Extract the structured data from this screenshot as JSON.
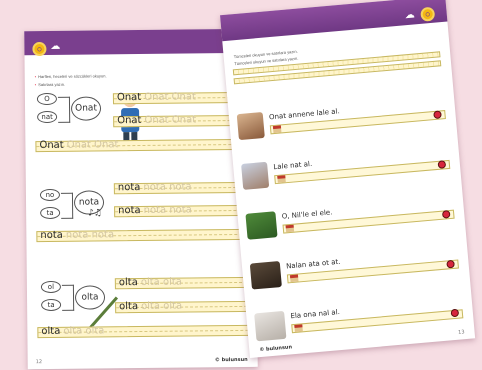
{
  "left_page": {
    "page_number": "12",
    "brand": "© bulunsun",
    "instructions": [
      "Harfleri, heceleri ve sözcükleri okuyun.",
      "Satırlara yazın."
    ],
    "groups": [
      {
        "syllables": [
          "O",
          "nat"
        ],
        "word": "Onat",
        "trace": "Onat Onat",
        "row3_trace": "Onat Onat"
      },
      {
        "syllables": [
          "no",
          "ta"
        ],
        "word": "nota",
        "trace": "nota nota",
        "row3_trace": "nota nota"
      },
      {
        "syllables": [
          "ol",
          "ta"
        ],
        "word": "olta",
        "trace": "olta olta",
        "row3_trace": "olta olta"
      }
    ]
  },
  "right_page": {
    "page_number": "13",
    "brand": "© bulunsun",
    "instructions": [
      "Tümceleri okuyun ve satırlara yazın.",
      "Tümceleri okuyun ve satırlara yazın."
    ],
    "sentences": [
      "Onat annene lale al.",
      "Lale nat al.",
      "O, Nil'le el ele.",
      "Nalan ata ot at.",
      "Ela ona nal al."
    ]
  },
  "colors": {
    "band": "#7a3f8e",
    "accent": "#f3b712",
    "line_fill": "#fff5cc",
    "background": "#f6dde3"
  },
  "icons": [
    "coin-icon",
    "lamb-icon",
    "book-icon",
    "ladybug-icon",
    "house-icon",
    "music-note-icon",
    "pencil-icon"
  ]
}
